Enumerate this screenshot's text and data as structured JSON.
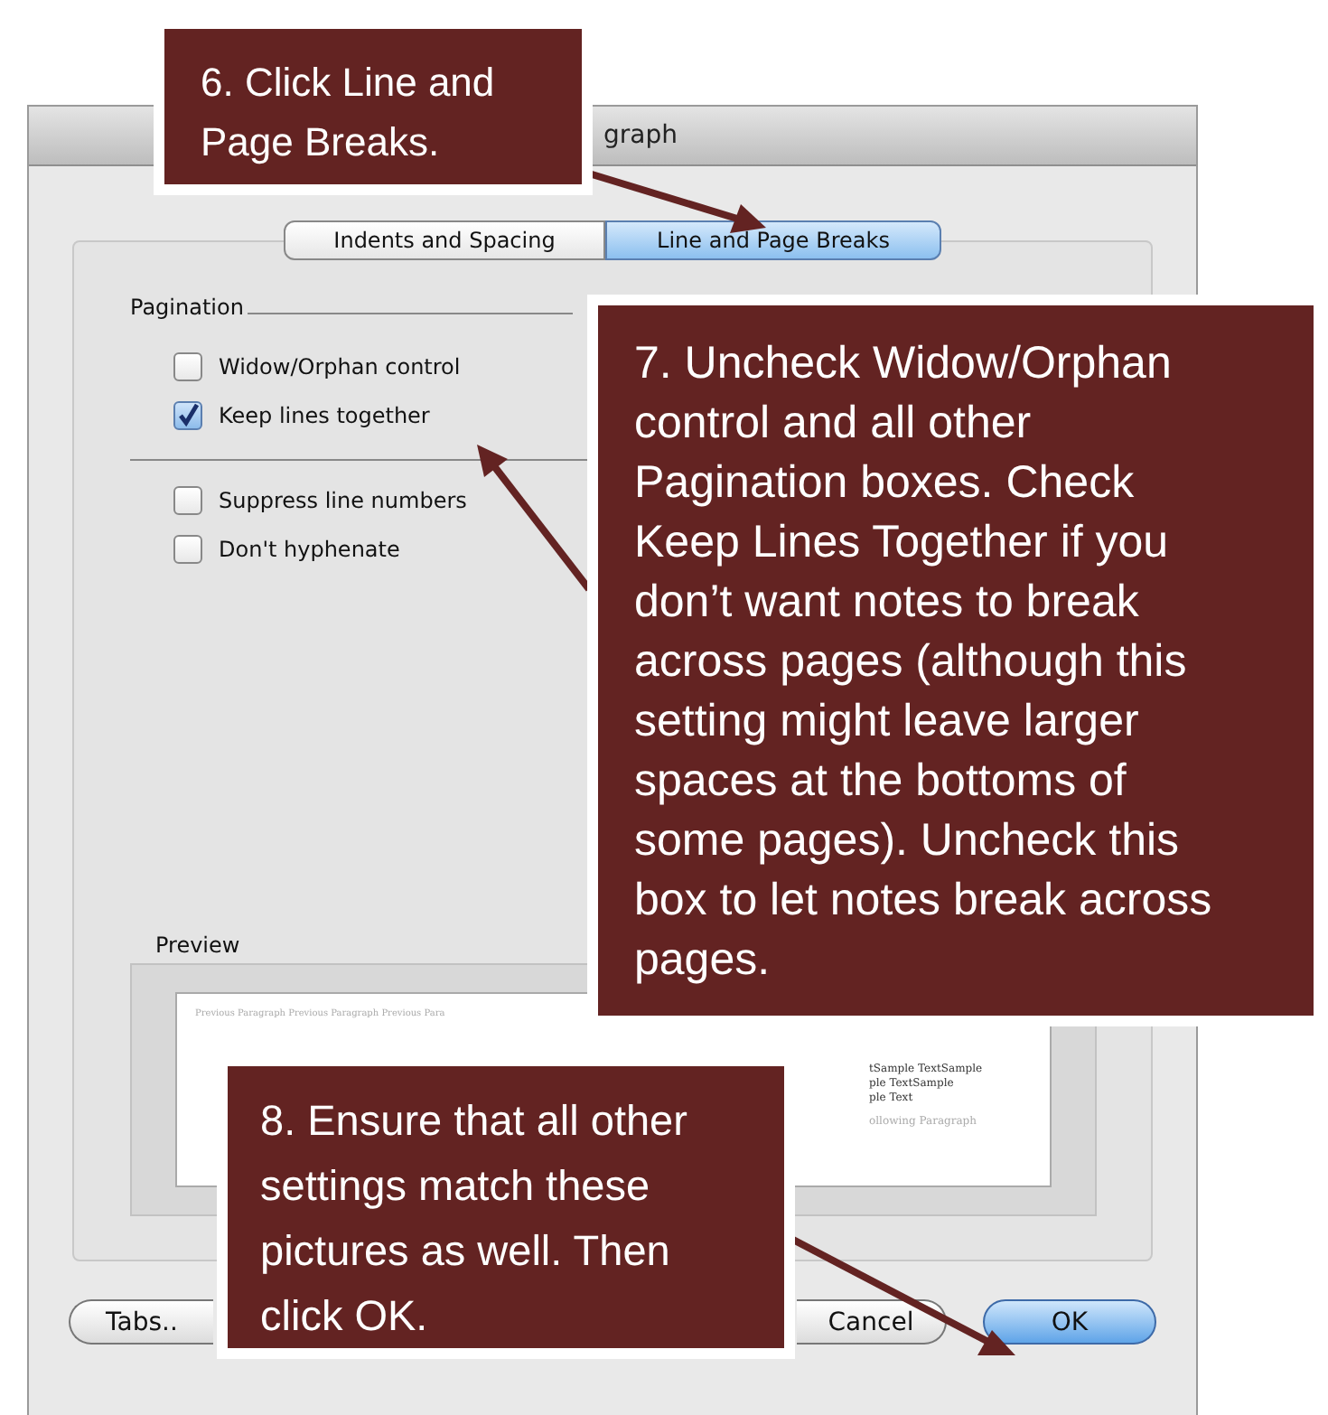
{
  "window": {
    "title": "graph"
  },
  "tabs": [
    {
      "label": "Indents and Spacing",
      "selected": false
    },
    {
      "label": "Line and Page Breaks",
      "selected": true
    }
  ],
  "pagination": {
    "label": "Pagination",
    "options": [
      {
        "label": "Widow/Orphan control",
        "checked": false
      },
      {
        "label": "Keep lines together",
        "checked": true
      }
    ]
  },
  "other_options": [
    {
      "label": "Suppress line numbers",
      "checked": false
    },
    {
      "label": "Don't hyphenate",
      "checked": false
    }
  ],
  "preview": {
    "label": "Preview",
    "previous_line": "Previous Paragraph Previous Paragraph Previous Para",
    "sample_lines": [
      "tSample TextSample",
      "ple TextSample",
      "ple Text"
    ],
    "following_lines": [
      "ollowing Paragraph"
    ]
  },
  "buttons": [
    {
      "label": "Tabs..",
      "default": false
    },
    {
      "label": "Cancel",
      "default": false
    },
    {
      "label": "OK",
      "default": true
    }
  ],
  "callouts": [
    {
      "text": "6. Click Line and Page Breaks."
    },
    {
      "text": "7. Uncheck Widow/Orphan control and all other Pagination boxes. Check Keep Lines Together if you don’t want notes to break across pages (although this setting might leave larger spaces at the bottoms of some pages). Uncheck this box to let notes break across pages."
    },
    {
      "text": "8. Ensure that all other settings match these pictures as well. Then click OK."
    }
  ]
}
